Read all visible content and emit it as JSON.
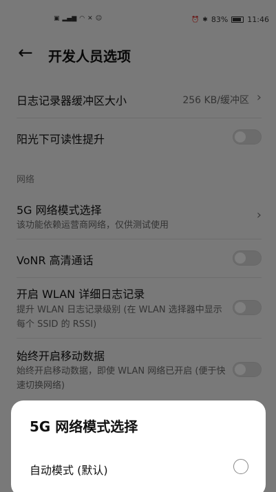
{
  "status_bar": {
    "left_icons": [
      "HD",
      "signal",
      "wifi",
      "nfc",
      "face"
    ],
    "battery": "83%",
    "time": "11:46"
  },
  "header": {
    "title": "开发人员选项"
  },
  "settings": {
    "log_buffer": {
      "title": "日志记录器缓冲区大小",
      "value": "256 KB/缓冲区"
    },
    "sunlight": {
      "title": "阳光下可读性提升"
    },
    "section_network": "网络",
    "nr_mode": {
      "title": "5G 网络模式选择",
      "subtitle": "该功能依赖运营商网络，仅供测试使用"
    },
    "vonr": {
      "title": "VoNR 高清通话"
    },
    "wlan_log": {
      "title": "开启 WLAN 详细日志记录",
      "subtitle": "提升 WLAN 日志记录级别 (在 WLAN 选择器中显示每个 SSID 的 RSSI)"
    },
    "mobile_data": {
      "title": "始终开启移动数据",
      "subtitle": "始终开启移动数据，即使 WLAN 网络已开启 (便于快速切换网络)"
    }
  },
  "dialog": {
    "title": "5G 网络模式选择",
    "options": [
      {
        "label": "自动模式 (默认)",
        "selected": false
      }
    ]
  }
}
